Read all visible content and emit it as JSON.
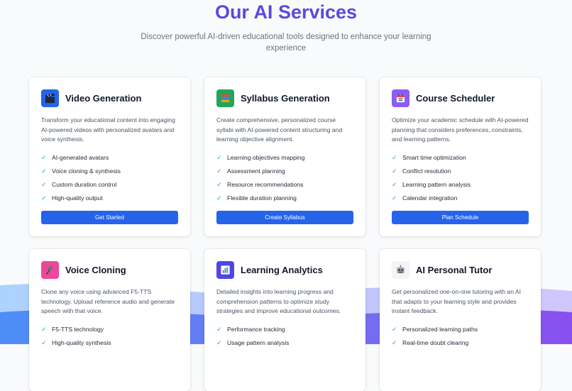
{
  "header": {
    "title": "Our AI Services",
    "subtitle": "Discover powerful AI-driven educational tools designed to enhance your learning experience"
  },
  "colors": {
    "title": "#5b48e0",
    "button": "#2563eb",
    "check": "#10b981"
  },
  "cards": [
    {
      "title": "Video Generation",
      "icon": "clapperboard-icon",
      "description": "Transform your educational content into engaging AI-powered videos with personalized avatars and voice synthesis.",
      "features": [
        "AI-generated avatars",
        "Voice cloning & synthesis",
        "Custom duration control",
        "High-quality output"
      ],
      "button": "Get Started"
    },
    {
      "title": "Syllabus Generation",
      "icon": "books-icon",
      "description": "Create comprehensive, personalized course syllabi with AI-powered content structuring and learning objective alignment.",
      "features": [
        "Learning objectives mapping",
        "Assessment planning",
        "Resource recommendations",
        "Flexible duration planning"
      ],
      "button": "Create Syllabus"
    },
    {
      "title": "Course Scheduler",
      "icon": "calendar-icon",
      "description": "Optimize your academic schedule with AI-powered planning that considers preferences, constraints, and learning patterns.",
      "features": [
        "Smart time optimization",
        "Conflict resolution",
        "Learning pattern analysis",
        "Calendar integration"
      ],
      "button": "Plan Schedule"
    },
    {
      "title": "Voice Cloning",
      "icon": "microphone-icon",
      "description": "Clone any voice using advanced F5-TTS technology. Upload reference audio and generate speech with that voice.",
      "features": [
        "F5-TTS technology",
        "High-quality synthesis"
      ]
    },
    {
      "title": "Learning Analytics",
      "icon": "bar-chart-icon",
      "description": "Detailed insights into learning progress and comprehension patterns to optimize study strategies and improve educational outcomes.",
      "features": [
        "Performance tracking",
        "Usage pattern analysis"
      ]
    },
    {
      "title": "AI Personal Tutor",
      "icon": "robot-icon",
      "description": "Get personalized one-on-one tutoring with an AI that adapts to your learning style and provides instant feedback.",
      "features": [
        "Personalized learning paths",
        "Real-time doubt clearing"
      ]
    }
  ]
}
